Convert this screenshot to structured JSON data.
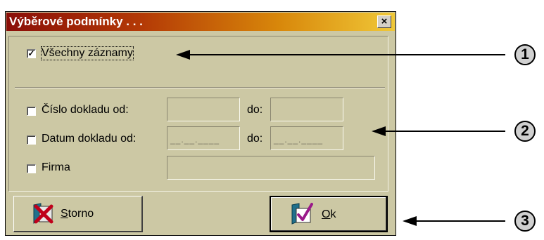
{
  "dialog": {
    "title": "Výběrové podmínky . . .",
    "close_label": "×",
    "all_records": {
      "label": "Všechny záznamy",
      "checked": true,
      "mark": "✓"
    },
    "doc_number": {
      "label": "Číslo dokladu  od:",
      "checked": false,
      "from": "",
      "to_label": "do:",
      "to": ""
    },
    "doc_date": {
      "label": "Datum dokladu od:",
      "checked": false,
      "from_mask": "__.__.____",
      "to_label": "do:",
      "to_mask": "__.__.____"
    },
    "company": {
      "label": "Firma",
      "checked": false,
      "value": ""
    },
    "cancel_button": {
      "underline": "S",
      "rest": "torno"
    },
    "ok_button": {
      "underline": "O",
      "rest": "k"
    }
  },
  "callouts": [
    "1",
    "2",
    "3"
  ]
}
